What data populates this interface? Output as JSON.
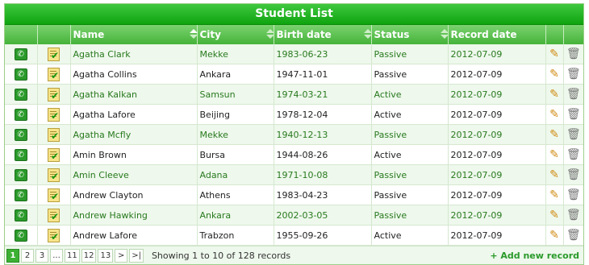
{
  "title": "Student List",
  "columns": {
    "name": "Name",
    "city": "City",
    "birth": "Birth date",
    "status": "Status",
    "record": "Record date"
  },
  "rows": [
    {
      "name": "Agatha Clark",
      "city": "Mekke",
      "birth": "1983-06-23",
      "status": "Passive",
      "record": "2012-07-09"
    },
    {
      "name": "Agatha Collins",
      "city": "Ankara",
      "birth": "1947-11-01",
      "status": "Passive",
      "record": "2012-07-09"
    },
    {
      "name": "Agatha Kalkan",
      "city": "Samsun",
      "birth": "1974-03-21",
      "status": "Active",
      "record": "2012-07-09"
    },
    {
      "name": "Agatha Lafore",
      "city": "Beijing",
      "birth": "1978-12-04",
      "status": "Active",
      "record": "2012-07-09"
    },
    {
      "name": "Agatha Mcfly",
      "city": "Mekke",
      "birth": "1940-12-13",
      "status": "Passive",
      "record": "2012-07-09"
    },
    {
      "name": "Amin Brown",
      "city": "Bursa",
      "birth": "1944-08-26",
      "status": "Active",
      "record": "2012-07-09"
    },
    {
      "name": "Amin Cleeve",
      "city": "Adana",
      "birth": "1971-10-08",
      "status": "Passive",
      "record": "2012-07-09"
    },
    {
      "name": "Andrew Clayton",
      "city": "Athens",
      "birth": "1983-04-23",
      "status": "Passive",
      "record": "2012-07-09"
    },
    {
      "name": "Andrew Hawking",
      "city": "Ankara",
      "birth": "2002-03-05",
      "status": "Passive",
      "record": "2012-07-09"
    },
    {
      "name": "Andrew Lafore",
      "city": "Trabzon",
      "birth": "1955-09-26",
      "status": "Active",
      "record": "2012-07-09"
    }
  ],
  "pagination": {
    "pages": [
      "1",
      "2",
      "3",
      "...",
      "11",
      "12",
      "13",
      ">",
      ">|"
    ],
    "active": "1",
    "showing": "Showing 1 to 10 of 128 records",
    "add": "+ Add new record"
  },
  "icons": {
    "phone": "phone-icon",
    "notes": "notes-icon",
    "edit": "pencil-icon",
    "delete": "trash-icon"
  }
}
